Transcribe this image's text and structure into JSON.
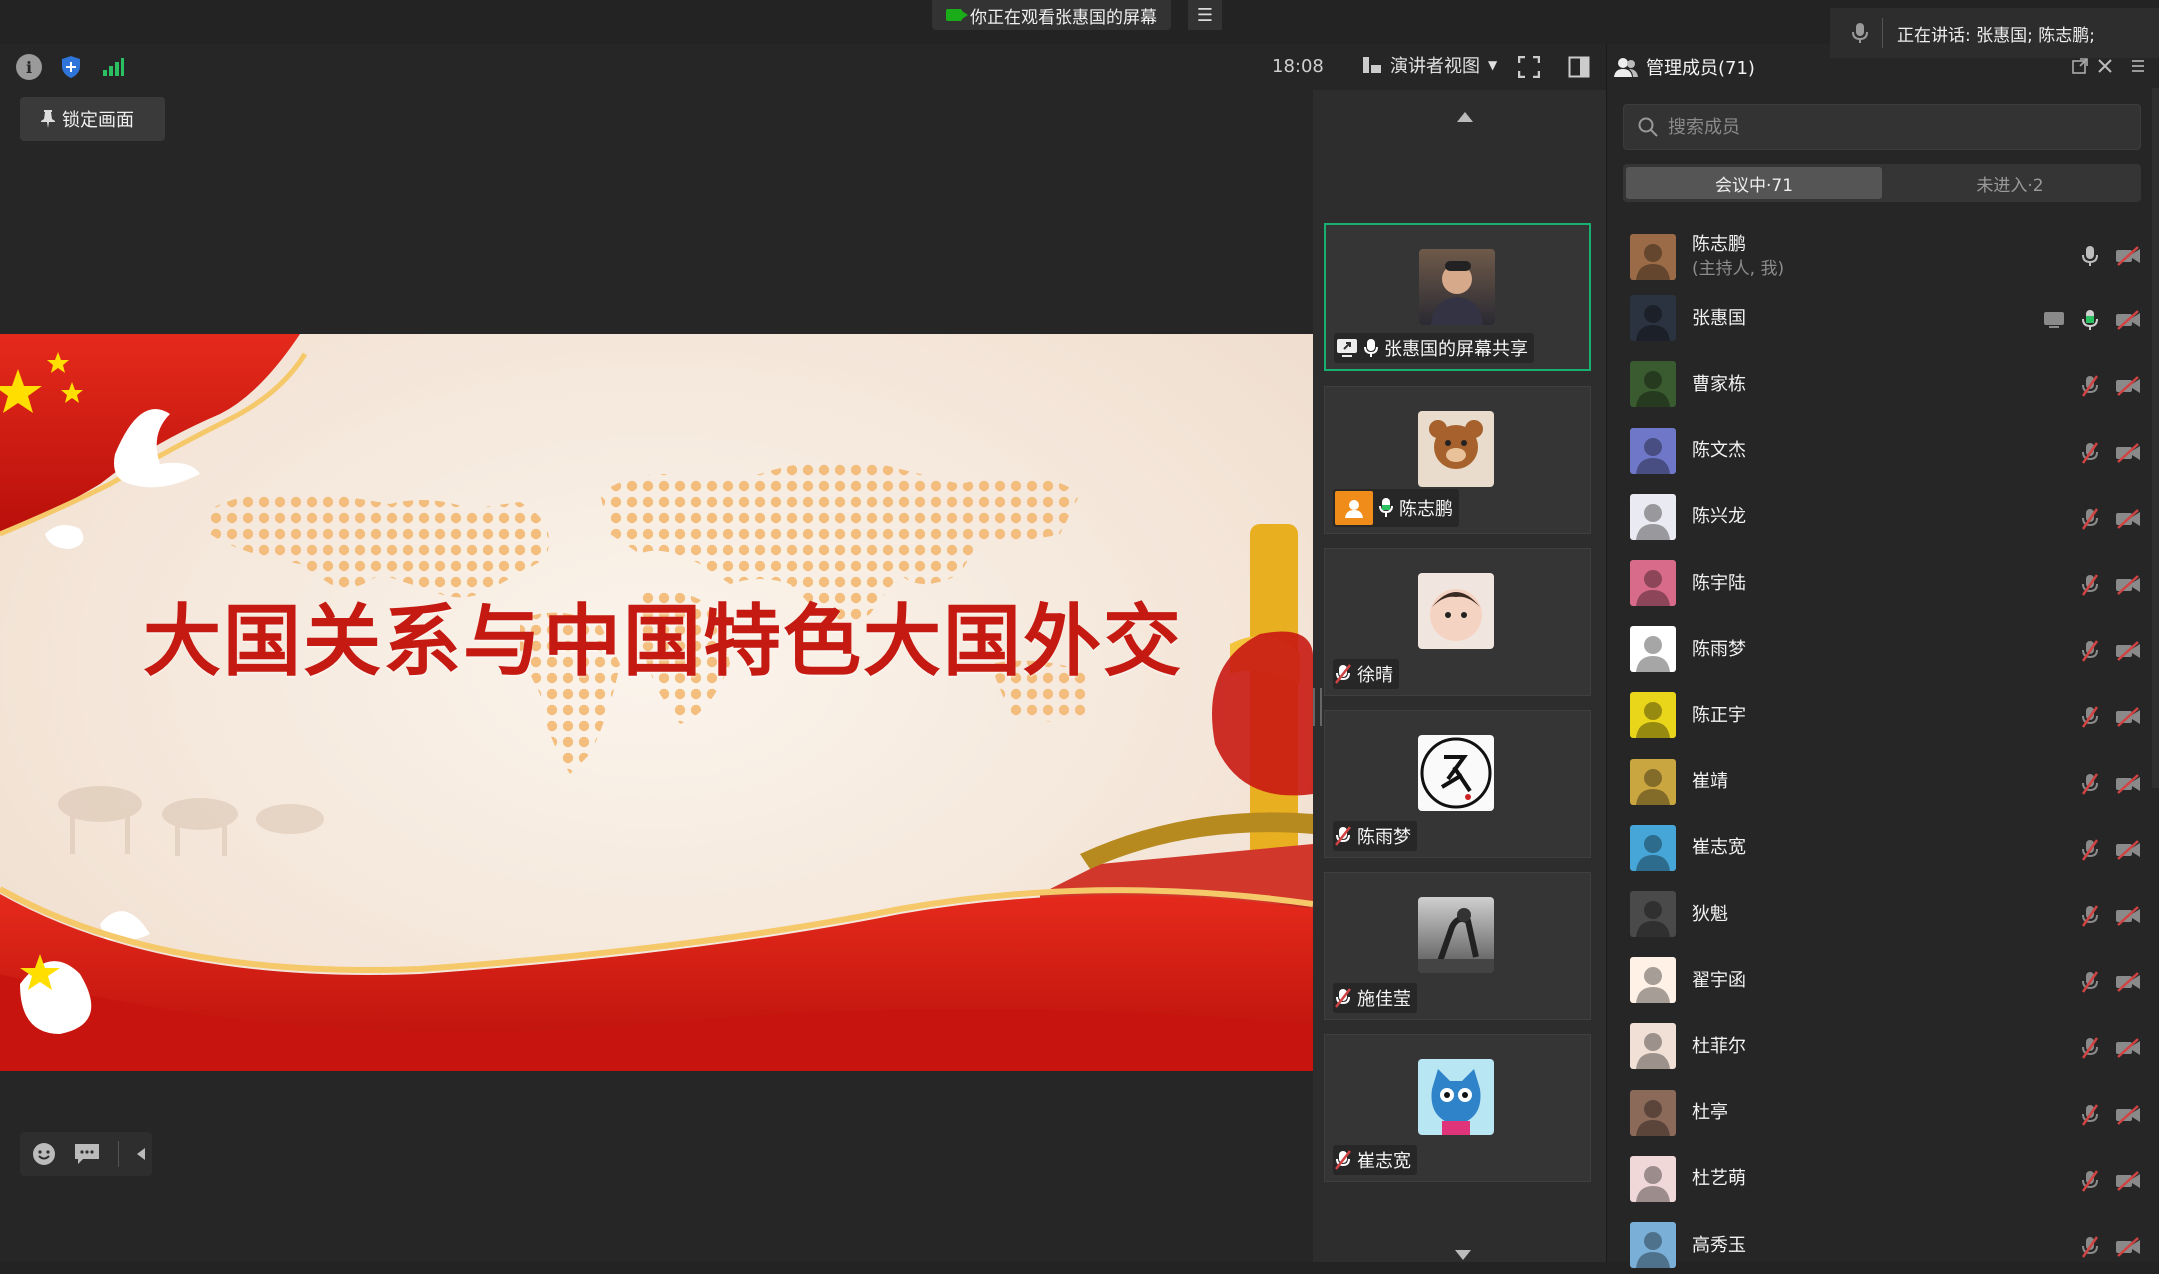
{
  "top": {
    "banner_text": "你正在观看张惠国的屏幕",
    "speaking_text": "正在讲话: 张惠国; 陈志鹏;"
  },
  "toolbar": {
    "time": "18:08",
    "view_label": "演讲者视图"
  },
  "main": {
    "lock_label": "锁定画面",
    "slide_title": "大国关系与中国特色大国外交"
  },
  "colors": {
    "active_border": "#18b070",
    "mic_active": "#2bc163",
    "mic_muted": "#d14343",
    "slide_title": "#c41a12"
  },
  "video_tiles": [
    {
      "name": "张惠国的屏幕共享",
      "status": "screen-share",
      "mic": "on"
    },
    {
      "name": "陈志鹏",
      "status": "host",
      "mic": "on"
    },
    {
      "name": "徐晴",
      "mic": "muted"
    },
    {
      "name": "陈雨梦",
      "mic": "muted"
    },
    {
      "name": "施佳莹",
      "mic": "muted"
    },
    {
      "name": "崔志宽",
      "mic": "muted"
    }
  ],
  "panel": {
    "title": "管理成员(71)",
    "search_placeholder": "搜索成员",
    "tab_in_meeting": "会议中·71",
    "tab_not_joined": "未进入·2"
  },
  "members": [
    {
      "name": "陈志鹏",
      "sub": "(主持人, 我)",
      "mic": "idle",
      "video": "off"
    },
    {
      "name": "张惠国",
      "sub": "",
      "mic": "active",
      "video": "off",
      "sharing": true
    },
    {
      "name": "曹家栋",
      "sub": "",
      "mic": "muted",
      "video": "off"
    },
    {
      "name": "陈文杰",
      "sub": "",
      "mic": "muted",
      "video": "off"
    },
    {
      "name": "陈兴龙",
      "sub": "",
      "mic": "muted",
      "video": "off"
    },
    {
      "name": "陈宇陆",
      "sub": "",
      "mic": "muted",
      "video": "off"
    },
    {
      "name": "陈雨梦",
      "sub": "",
      "mic": "muted",
      "video": "off"
    },
    {
      "name": "陈正宇",
      "sub": "",
      "mic": "muted",
      "video": "off"
    },
    {
      "name": "崔靖",
      "sub": "",
      "mic": "muted",
      "video": "off"
    },
    {
      "name": "崔志宽",
      "sub": "",
      "mic": "muted",
      "video": "off"
    },
    {
      "name": "狄魁",
      "sub": "",
      "mic": "muted",
      "video": "off"
    },
    {
      "name": "翟宇函",
      "sub": "",
      "mic": "muted",
      "video": "off"
    },
    {
      "name": "杜菲尔",
      "sub": "",
      "mic": "muted",
      "video": "off"
    },
    {
      "name": "杜亭",
      "sub": "",
      "mic": "muted",
      "video": "off"
    },
    {
      "name": "杜艺萌",
      "sub": "",
      "mic": "muted",
      "video": "off"
    },
    {
      "name": "高秀玉",
      "sub": "",
      "mic": "muted",
      "video": "off"
    }
  ]
}
